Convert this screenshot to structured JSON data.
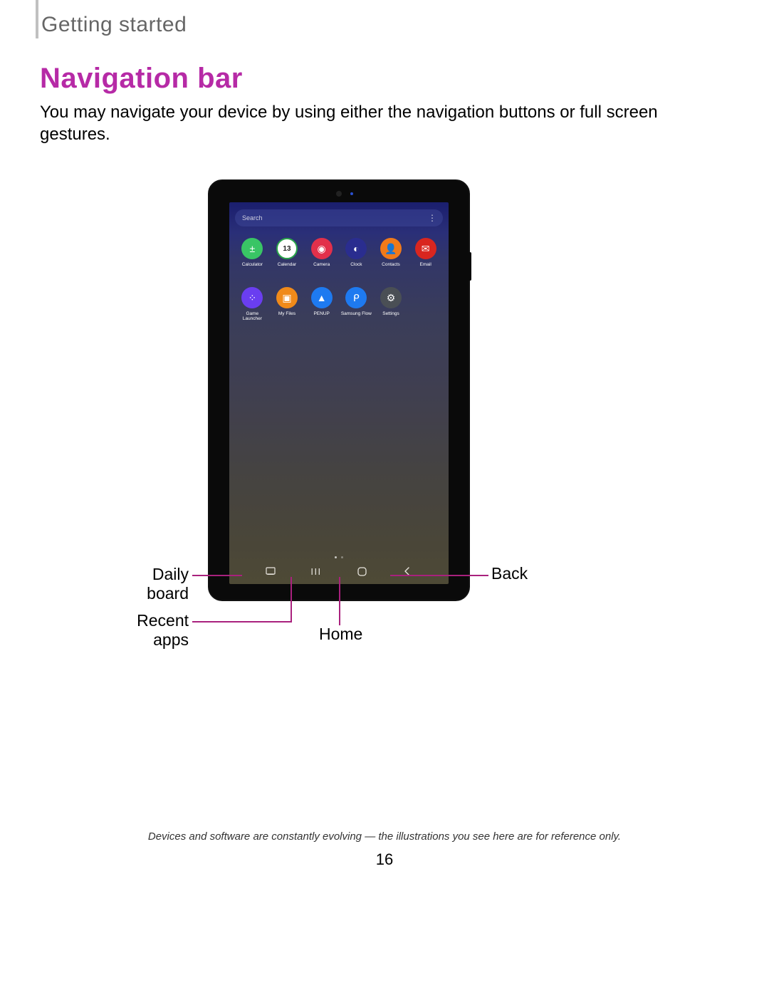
{
  "header": {
    "section": "Getting started"
  },
  "heading": "Navigation bar",
  "body": "You may navigate your device by using either the navigation buttons or full screen gestures.",
  "tablet": {
    "search_placeholder": "Search",
    "apps_row1": [
      {
        "label": "Calculator",
        "color": "#39c565",
        "glyph": "±"
      },
      {
        "label": "Calendar",
        "color": "#2aa54a",
        "glyph": "13"
      },
      {
        "label": "Camera",
        "color": "#e2304b",
        "glyph": "◉"
      },
      {
        "label": "Clock",
        "color": "#2a2d8f",
        "glyph": "◐"
      },
      {
        "label": "Contacts",
        "color": "#f17a1a",
        "glyph": "👤"
      },
      {
        "label": "Email",
        "color": "#d9261f",
        "glyph": "✉"
      }
    ],
    "apps_row2": [
      {
        "label": "Game Launcher",
        "color": "#6a3ef0",
        "glyph": "⁘",
        "wrap": true
      },
      {
        "label": "My Files",
        "color": "#f08a1a",
        "glyph": "▣"
      },
      {
        "label": "PENUP",
        "color": "#1e7af0",
        "glyph": "▲"
      },
      {
        "label": "Samsung Flow",
        "color": "#1e7af0",
        "glyph": "ᑭ"
      },
      {
        "label": "Settings",
        "color": "#4a4f55",
        "glyph": "⚙"
      }
    ]
  },
  "callouts": {
    "daily_board": "Daily board",
    "recent_apps": "Recent apps",
    "home": "Home",
    "back": "Back"
  },
  "footnote": "Devices and software are constantly evolving — the illustrations you see here are for reference only.",
  "page_number": "16"
}
